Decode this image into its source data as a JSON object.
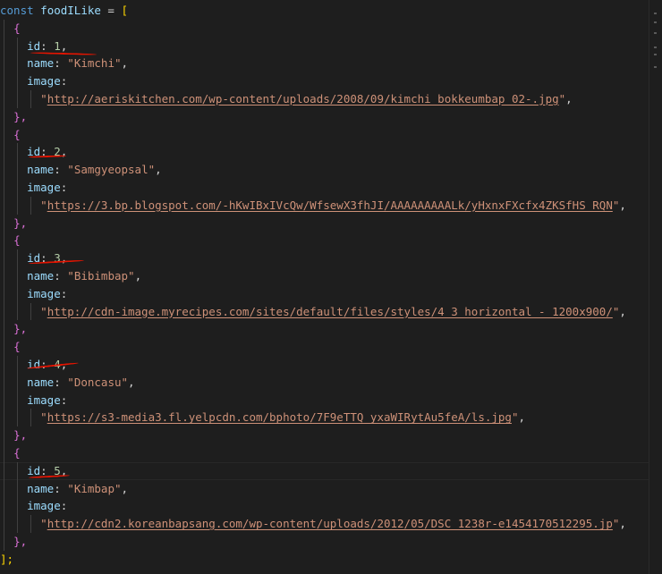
{
  "code": {
    "declaration_keyword": "const",
    "variable_name": "foodILike",
    "assign": " = ",
    "open_array": "[",
    "close_array": "];",
    "open_object": "{",
    "close_object": "},",
    "key_id": "id",
    "key_name": "name",
    "key_image": "image",
    "colon": ":",
    "comma": ",",
    "quote": "\"",
    "items": [
      {
        "id": "1",
        "name": "Kimchi",
        "image": "http://aeriskitchen.com/wp-content/uploads/2008/09/kimchi_bokkeumbap_02-.jpg"
      },
      {
        "id": "2",
        "name": "Samgyeopsal",
        "image": "https://3.bp.blogspot.com/-hKwIBxIVcQw/WfsewX3fhJI/AAAAAAAAALk/yHxnxFXcfx4ZKSfHS_RQN"
      },
      {
        "id": "3",
        "name": "Bibimbap",
        "image": "http://cdn-image.myrecipes.com/sites/default/files/styles/4_3_horizontal_-_1200x900/"
      },
      {
        "id": "4",
        "name": "Doncasu",
        "image": "https://s3-media3.fl.yelpcdn.com/bphoto/7F9eTTQ_yxaWIRytAu5feA/ls.jpg"
      },
      {
        "id": "5",
        "name": "Kimbap",
        "image": "http://cdn2.koreanbapsang.com/wp-content/uploads/2012/05/DSC_1238r-e1454170512295.jp"
      }
    ]
  },
  "colors": {
    "background": "#1e1e1e",
    "keyword": "#569cd6",
    "property": "#9cdcfe",
    "number": "#b5cea8",
    "string": "#ce9178",
    "annotation": "#e51400"
  }
}
